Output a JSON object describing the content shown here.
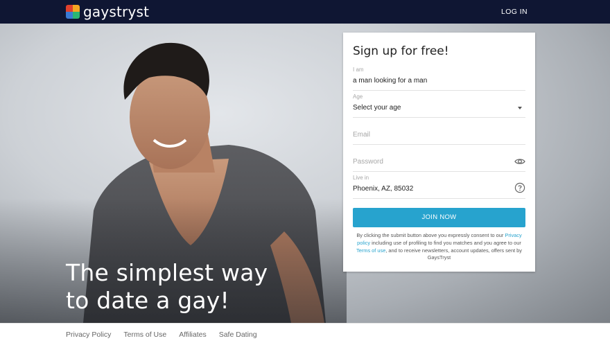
{
  "header": {
    "brand_name": "gaystryst",
    "login_label": "LOG IN",
    "logo_colors": [
      "#e0412d",
      "#f5a623",
      "#3a7bd5",
      "#2bb673"
    ]
  },
  "hero": {
    "tagline_line1": "The simplest way",
    "tagline_line2": "to date a gay!"
  },
  "signup_form": {
    "title": "Sign up for free!",
    "i_am": {
      "label": "I am",
      "value": "a man looking for a man"
    },
    "age": {
      "label": "Age",
      "value": "Select your age"
    },
    "email": {
      "placeholder": "Email"
    },
    "password": {
      "placeholder": "Password"
    },
    "live_in": {
      "label": "Live in",
      "value": "Phoenix, AZ, 85032"
    },
    "submit_label": "JOIN NOW",
    "consent": {
      "part1": "By clicking the submit button above you expressly consent to our ",
      "privacy_link": "Privacy policy",
      "part2": " including use of profiling to find you matches and you agree to our ",
      "terms_link": "Terms of use",
      "part3": ", and to receive newsletters, account updates, offers sent by GaysTryst"
    }
  },
  "footer": {
    "links": [
      "Privacy Policy",
      "Terms of Use",
      "Affiliates",
      "Safe Dating"
    ]
  },
  "colors": {
    "header_bg": "#0f1633",
    "accent": "#27a3ce"
  }
}
